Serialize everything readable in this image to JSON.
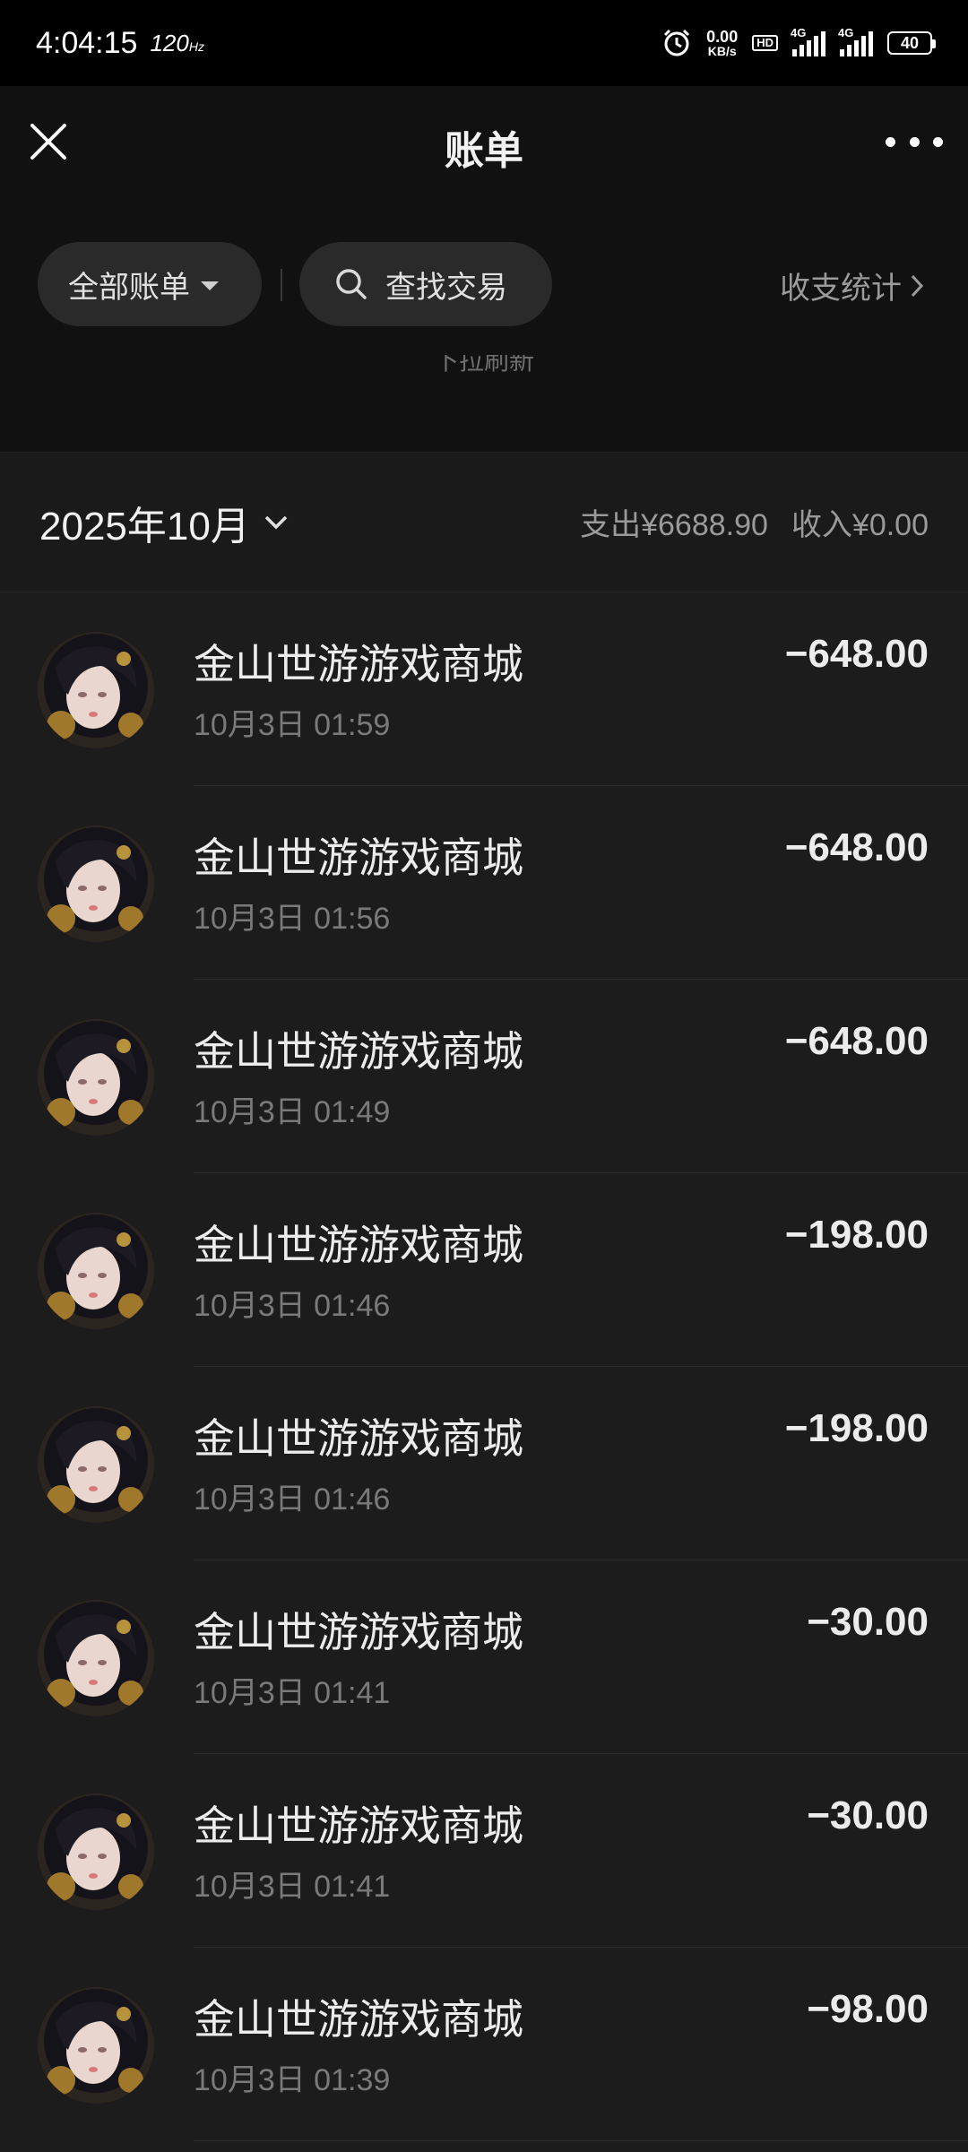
{
  "status_bar": {
    "time": "4:04:15",
    "refresh_rate": "120",
    "refresh_unit": "Hz",
    "net_speed_value": "0.00",
    "net_speed_unit": "KB/s",
    "hd_label": "HD",
    "signal1_label": "4G",
    "signal2_label": "4G",
    "battery": "40"
  },
  "nav": {
    "title": "账单"
  },
  "filters": {
    "all_bills_label": "全部账单",
    "search_label": "查找交易",
    "stats_label": "收支统计"
  },
  "pull_hint": "下拉刷新",
  "month": {
    "label": "2025年10月",
    "expense": "支出¥6688.90",
    "income": "收入¥0.00"
  },
  "transactions": [
    {
      "name": "金山世游游戏商城",
      "time": "10月3日 01:59",
      "amount": "−648.00"
    },
    {
      "name": "金山世游游戏商城",
      "time": "10月3日 01:56",
      "amount": "−648.00"
    },
    {
      "name": "金山世游游戏商城",
      "time": "10月3日 01:49",
      "amount": "−648.00"
    },
    {
      "name": "金山世游游戏商城",
      "time": "10月3日 01:46",
      "amount": "−198.00"
    },
    {
      "name": "金山世游游戏商城",
      "time": "10月3日 01:46",
      "amount": "−198.00"
    },
    {
      "name": "金山世游游戏商城",
      "time": "10月3日 01:41",
      "amount": "−30.00"
    },
    {
      "name": "金山世游游戏商城",
      "time": "10月3日 01:41",
      "amount": "−30.00"
    },
    {
      "name": "金山世游游戏商城",
      "time": "10月3日 01:39",
      "amount": "−98.00"
    }
  ],
  "colors": {
    "background": "#111111",
    "list_background": "#1c1c1c",
    "primary_text": "#ececec",
    "secondary_text": "#7a7a7a"
  }
}
